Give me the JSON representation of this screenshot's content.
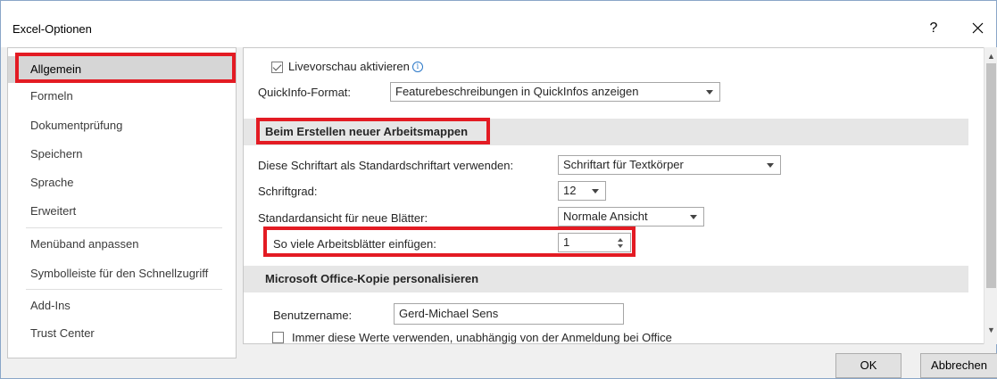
{
  "window": {
    "title": "Excel-Optionen",
    "help_glyph": "?",
    "close_glyph": "×"
  },
  "sidebar": {
    "items": [
      {
        "label": "Allgemein"
      },
      {
        "label": "Formeln"
      },
      {
        "label": "Dokumentprüfung"
      },
      {
        "label": "Speichern"
      },
      {
        "label": "Sprache"
      },
      {
        "label": "Erweitert"
      },
      {
        "label": "Menüband anpassen"
      },
      {
        "label": "Symbolleiste für den Schnellzugriff"
      },
      {
        "label": "Add-Ins"
      },
      {
        "label": "Trust Center"
      }
    ],
    "selected": "Allgemein"
  },
  "ui_options": {
    "live_preview_label": "Livevorschau aktivieren",
    "live_preview_checked": true,
    "info_glyph": "i",
    "quickinfo_label": "QuickInfo-Format:",
    "quickinfo_value": "Featurebeschreibungen in QuickInfos anzeigen"
  },
  "new_workbook": {
    "header": "Beim Erstellen neuer Arbeitsmappen",
    "font_label": "Diese Schriftart als Standardschriftart verwenden:",
    "font_value": "Schriftart für Textkörper",
    "size_label": "Schriftgrad:",
    "size_value": "12",
    "view_label": "Standardansicht für neue Blätter:",
    "view_value": "Normale Ansicht",
    "sheets_label": "So viele Arbeitsblätter einfügen:",
    "sheets_value": "1"
  },
  "personalize": {
    "header": "Microsoft Office-Kopie personalisieren",
    "username_label": "Benutzername:",
    "username_value": "Gerd-Michael Sens",
    "always_use_label": "Immer diese Werte verwenden, unabhängig von der Anmeldung bei Office",
    "always_use_checked": false
  },
  "footer": {
    "ok_label": "OK",
    "cancel_label": "Abbrechen"
  },
  "colors": {
    "highlight": "#e31b23",
    "selected_bg": "#d6d6d6",
    "section_bg": "#e6e6e6"
  }
}
